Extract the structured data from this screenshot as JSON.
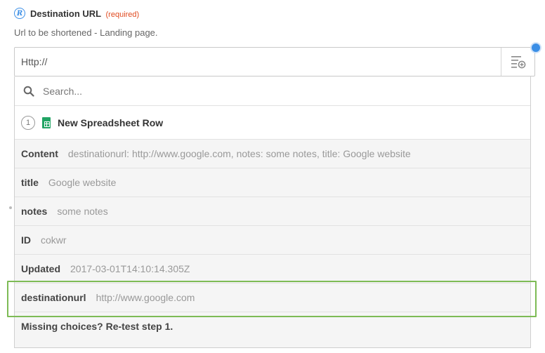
{
  "field": {
    "icon": "zapier-r-icon",
    "label": "Destination URL",
    "required": "(required)",
    "help": "Url to be shortened - Landing page."
  },
  "input": {
    "value": "Http://",
    "insert_icon": "insert-field-icon"
  },
  "dropdown": {
    "search_placeholder": "Search...",
    "step": {
      "number": "1",
      "app_icon": "google-sheets-icon",
      "title": "New Spreadsheet Row"
    },
    "rows": [
      {
        "key": "Content",
        "value": "destinationurl: http://www.google.com, notes: some notes, title: Google website"
      },
      {
        "key": "title",
        "value": "Google website"
      },
      {
        "key": "notes",
        "value": "some notes"
      },
      {
        "key": "ID",
        "value": "cokwr"
      },
      {
        "key": "Updated",
        "value": "2017-03-01T14:10:14.305Z"
      },
      {
        "key": "destinationurl",
        "value": "http://www.google.com"
      }
    ],
    "missing": "Missing choices? Re-test step 1."
  },
  "colors": {
    "accent": "#3a8ee6",
    "required": "#e04a1f",
    "highlight": "#7dbb55",
    "sheets": "#21a464"
  }
}
